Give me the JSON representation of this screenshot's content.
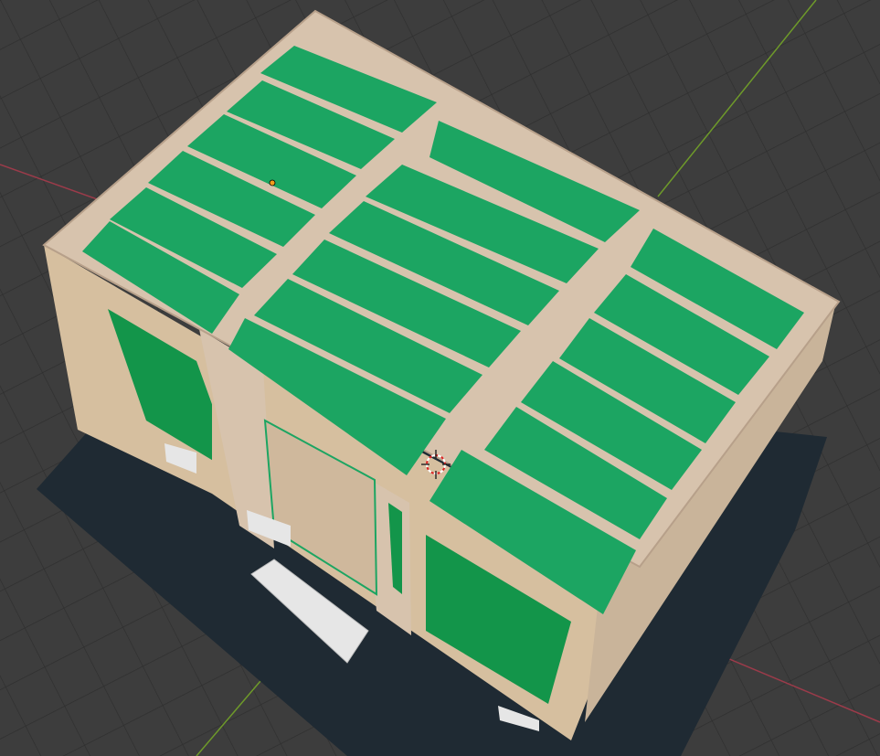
{
  "app": {
    "view": "3D Viewport"
  },
  "colors": {
    "background": "#3d3d3d",
    "grid_line": "#2f2f2f",
    "x_axis": "#9b3b4a",
    "y_axis": "#6e9a2a",
    "ground_slab": "#1f2a33",
    "timber": "#d7c3ad",
    "timber_dark": "#b7a08a",
    "panel_green": "#1ca562",
    "panel_green_dark": "#13954a",
    "wall_osb": "#d6bf9f",
    "door": "#cfb89c",
    "block": "#e6e6e6",
    "origin": "#f29d1c"
  },
  "icons": {
    "origin": "origin-dot-icon",
    "cursor": "3d-cursor-icon"
  },
  "scene": {
    "objects": [
      "floor-frame",
      "floor-panels",
      "walls",
      "door",
      "concrete-blocks"
    ]
  }
}
